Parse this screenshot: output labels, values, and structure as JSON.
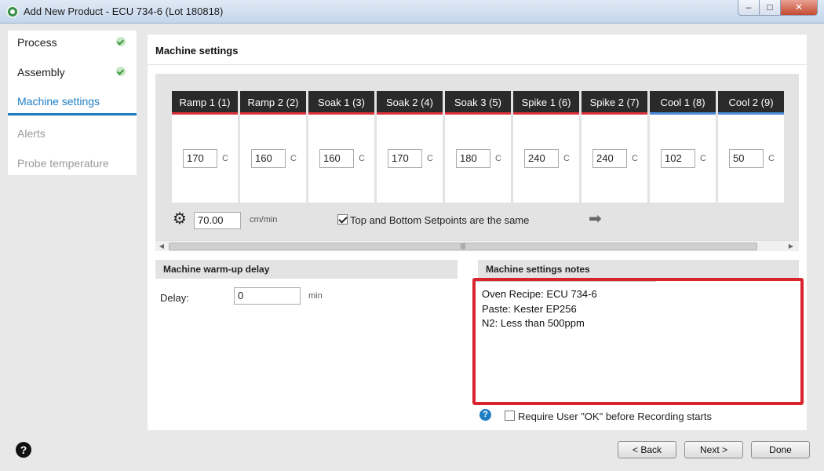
{
  "window": {
    "title": "Add New Product - ECU 734-6 (Lot 180818)",
    "min_label": "–",
    "max_label": "□",
    "close_label": "✕"
  },
  "sidebar": {
    "items": [
      {
        "label": "Process",
        "state": "done"
      },
      {
        "label": "Assembly",
        "state": "done"
      },
      {
        "label": "Machine settings",
        "state": "active"
      },
      {
        "label": "Alerts",
        "state": "disabled"
      },
      {
        "label": "Probe temperature",
        "state": "disabled"
      }
    ]
  },
  "main": {
    "title": "Machine settings",
    "zones": [
      {
        "name": "Ramp 1 (1)",
        "value": "170",
        "unit": "C",
        "kind": "heat"
      },
      {
        "name": "Ramp 2 (2)",
        "value": "160",
        "unit": "C",
        "kind": "heat"
      },
      {
        "name": "Soak 1 (3)",
        "value": "160",
        "unit": "C",
        "kind": "heat"
      },
      {
        "name": "Soak 2 (4)",
        "value": "170",
        "unit": "C",
        "kind": "heat"
      },
      {
        "name": "Soak 3 (5)",
        "value": "180",
        "unit": "C",
        "kind": "heat"
      },
      {
        "name": "Spike 1 (6)",
        "value": "240",
        "unit": "C",
        "kind": "heat"
      },
      {
        "name": "Spike 2 (7)",
        "value": "240",
        "unit": "C",
        "kind": "heat"
      },
      {
        "name": "Cool 1 (8)",
        "value": "102",
        "unit": "C",
        "kind": "cool"
      },
      {
        "name": "Cool 2 (9)",
        "value": "50",
        "unit": "C",
        "kind": "cool"
      }
    ],
    "conveyor": {
      "value": "70.00",
      "unit": "cm/min"
    },
    "same_setpoints": {
      "label": "Top and Bottom Setpoints are the same",
      "checked": true
    },
    "warmup": {
      "title": "Machine warm-up delay",
      "delay_label": "Delay:",
      "delay_value": "0",
      "delay_unit": "min"
    },
    "notes": {
      "title": "Machine settings notes",
      "text": "Oven Recipe: ECU 734-6\nPaste: Kester EP256\nN2: Less than 500ppm"
    },
    "require_ok": {
      "label": "Require User \"OK\" before Recording starts",
      "checked": false
    }
  },
  "footer": {
    "help": "?",
    "back_label": "< Back",
    "next_label": "Next >",
    "done_label": "Done"
  },
  "colors": {
    "accent": "#1f7fc4",
    "heat": "#d9323a",
    "cool": "#4a8ad6",
    "highlight": "#d9232d"
  }
}
